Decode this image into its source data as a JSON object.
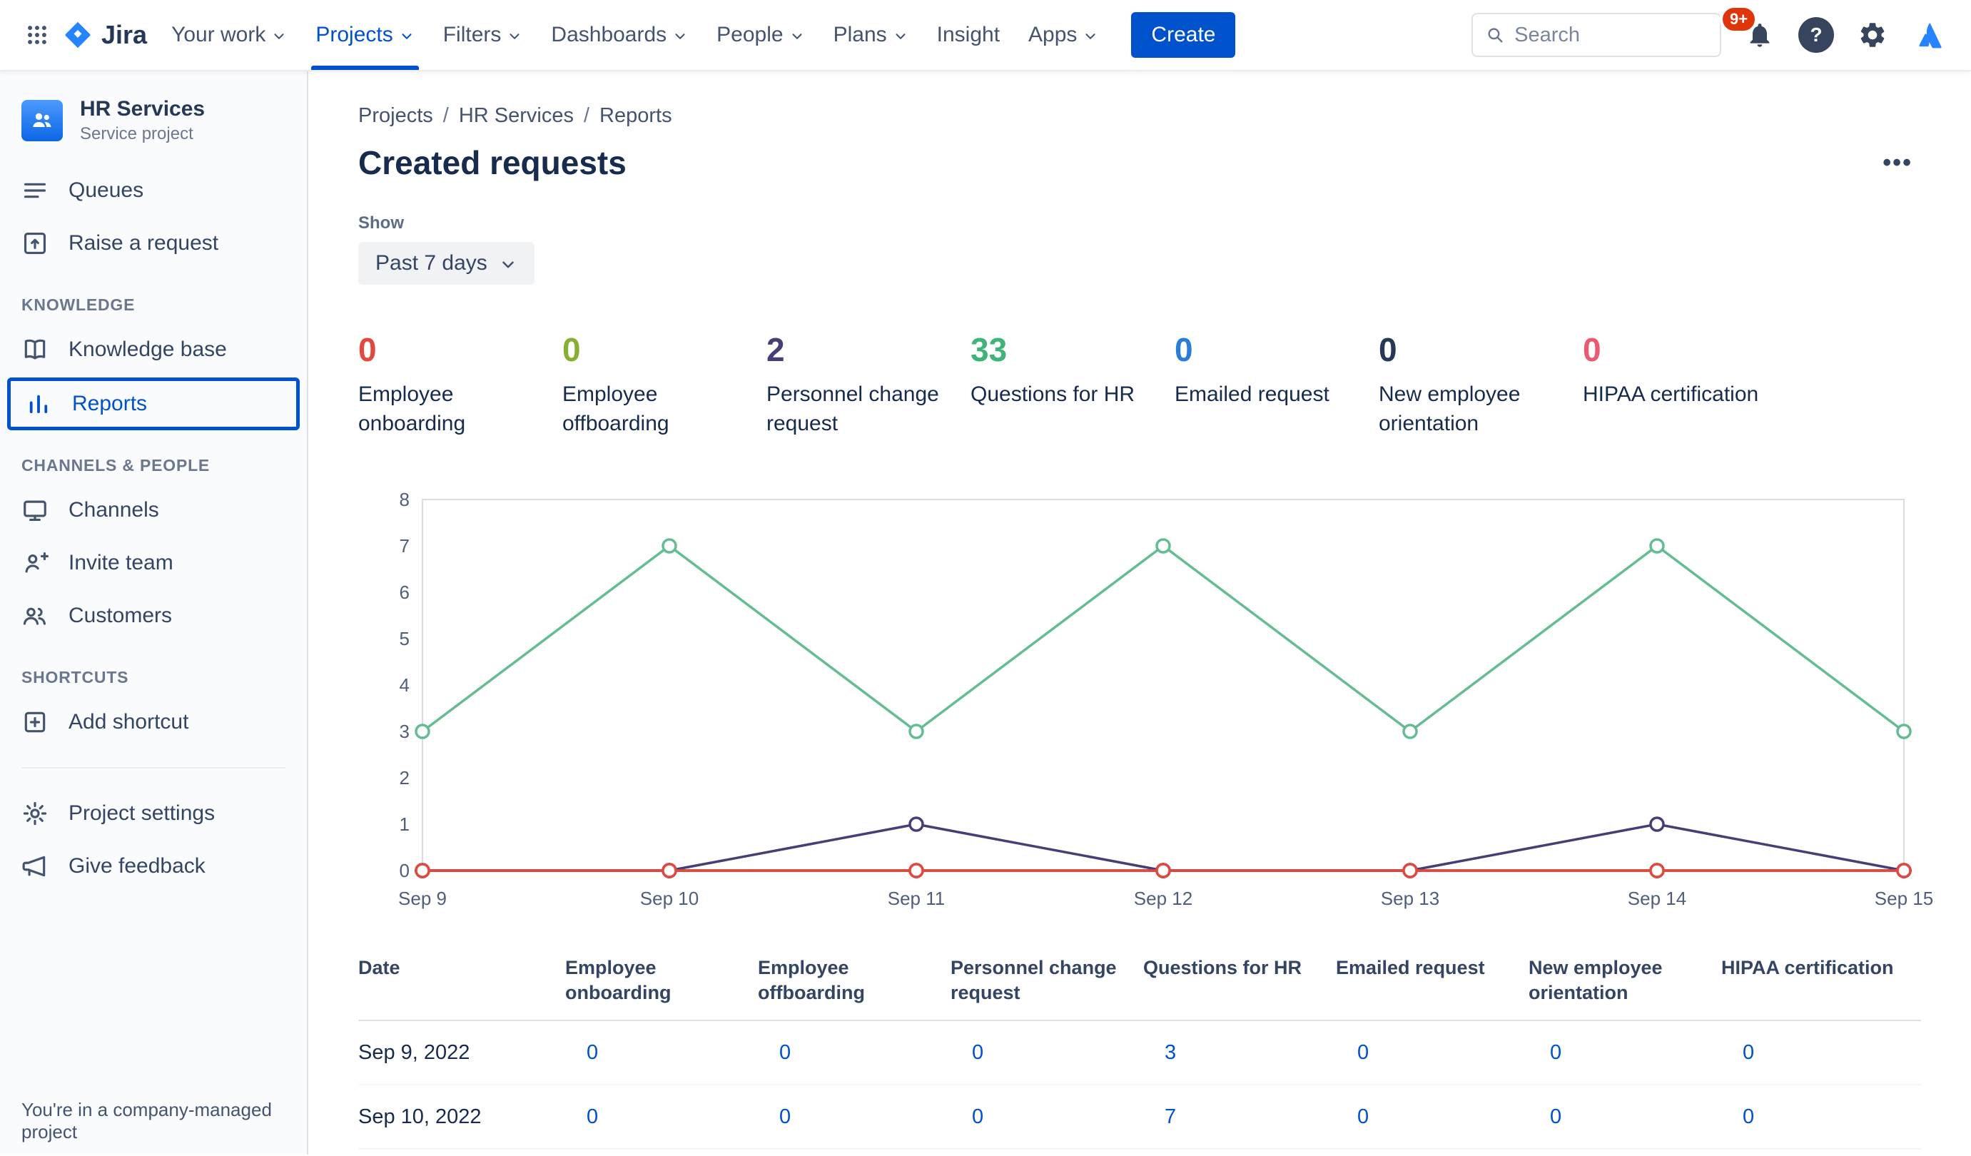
{
  "topnav": {
    "logo_text": "Jira",
    "items": [
      {
        "label": "Your work",
        "chevron": true,
        "active": false
      },
      {
        "label": "Projects",
        "chevron": true,
        "active": true
      },
      {
        "label": "Filters",
        "chevron": true,
        "active": false
      },
      {
        "label": "Dashboards",
        "chevron": true,
        "active": false
      },
      {
        "label": "People",
        "chevron": true,
        "active": false
      },
      {
        "label": "Plans",
        "chevron": true,
        "active": false
      },
      {
        "label": "Insight",
        "chevron": false,
        "active": false
      },
      {
        "label": "Apps",
        "chevron": true,
        "active": false
      }
    ],
    "create_label": "Create",
    "search_placeholder": "Search",
    "notification_badge": "9+",
    "help_label": "?"
  },
  "sidebar": {
    "project_name": "HR Services",
    "project_type": "Service project",
    "queues": "Queues",
    "raise_request": "Raise a request",
    "knowledge_header": "KNOWLEDGE",
    "knowledge_base": "Knowledge base",
    "reports": "Reports",
    "channels_header": "CHANNELS & PEOPLE",
    "channels": "Channels",
    "invite_team": "Invite team",
    "customers": "Customers",
    "shortcuts_header": "SHORTCUTS",
    "add_shortcut": "Add shortcut",
    "project_settings": "Project settings",
    "give_feedback": "Give feedback",
    "footer_note": "You're in a company-managed project"
  },
  "main": {
    "breadcrumb": [
      "Projects",
      "HR Services",
      "Reports"
    ],
    "breadcrumb_separator": "/",
    "title": "Created requests",
    "more_label": "•••",
    "show_label": "Show",
    "filter_value": "Past 7 days",
    "stats": [
      {
        "value": "0",
        "label": "Employee onboarding",
        "color": "#E2483D"
      },
      {
        "value": "0",
        "label": "Employee offboarding",
        "color": "#86B031"
      },
      {
        "value": "2",
        "label": "Personnel change request",
        "color": "#463E77"
      },
      {
        "value": "33",
        "label": "Questions for HR",
        "color": "#3FB478"
      },
      {
        "value": "0",
        "label": "Emailed request",
        "color": "#2B7CD9"
      },
      {
        "value": "0",
        "label": "New employee orientation",
        "color": "#253858"
      },
      {
        "value": "0",
        "label": "HIPAA certification",
        "color": "#EA5A72"
      }
    ]
  },
  "chart_data": {
    "type": "line",
    "title": "Created requests",
    "x": [
      "Sep 9",
      "Sep 10",
      "Sep 11",
      "Sep 12",
      "Sep 13",
      "Sep 14",
      "Sep 15"
    ],
    "ylim": [
      0,
      8
    ],
    "yticks": [
      0,
      1,
      2,
      3,
      4,
      5,
      6,
      7,
      8
    ],
    "grid": false,
    "legend": "none",
    "series": [
      {
        "name": "Emailed request",
        "color": "#2B7CD9",
        "values": [
          0,
          0,
          0,
          0,
          0,
          0,
          0
        ]
      },
      {
        "name": "New employee orientation",
        "color": "#253858",
        "values": [
          0,
          0,
          0,
          0,
          0,
          0,
          0
        ]
      },
      {
        "name": "Employee offboarding",
        "color": "#86B031",
        "values": [
          0,
          0,
          0,
          0,
          0,
          0,
          0
        ]
      },
      {
        "name": "HIPAA certification",
        "color": "#EA5A72",
        "values": [
          0,
          0,
          0,
          0,
          0,
          0,
          0
        ]
      },
      {
        "name": "Personnel change request",
        "color": "#463E77",
        "values": [
          0,
          0,
          1,
          0,
          0,
          1,
          0
        ]
      },
      {
        "name": "Employee onboarding",
        "color": "#E2483D",
        "values": [
          0,
          0,
          0,
          0,
          0,
          0,
          0
        ]
      },
      {
        "name": "Questions for HR",
        "color": "#64BD92",
        "values": [
          3,
          7,
          3,
          7,
          3,
          7,
          3
        ]
      }
    ]
  },
  "table": {
    "headers": [
      "Date",
      "Employee onboarding",
      "Employee offboarding",
      "Personnel change request",
      "Questions for HR",
      "Emailed request",
      "New employee orientation",
      "HIPAA certification"
    ],
    "rows": [
      {
        "date": "Sep 9, 2022",
        "values": [
          "0",
          "0",
          "0",
          "3",
          "0",
          "0",
          "0"
        ]
      },
      {
        "date": "Sep 10, 2022",
        "values": [
          "0",
          "0",
          "0",
          "7",
          "0",
          "0",
          "0"
        ]
      }
    ]
  }
}
